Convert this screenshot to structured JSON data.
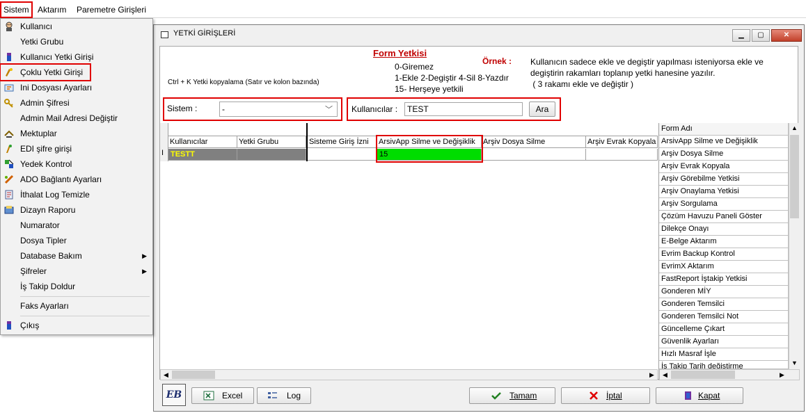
{
  "menubar": {
    "items": [
      {
        "label": "Sistem"
      },
      {
        "label": "Aktarım"
      },
      {
        "label": "Paremetre Girişleri"
      }
    ]
  },
  "dropdown": {
    "items": [
      {
        "label": "Kullanıcı",
        "icon": "user-icon"
      },
      {
        "label": "Yetki Grubu",
        "icon": ""
      },
      {
        "label": "Kullanıcı Yetki Girişi",
        "icon": "user-permission-icon"
      },
      {
        "label": "Çoklu Yetki Girişi",
        "icon": "multi-permission-icon"
      },
      {
        "label": "Ini Dosyası  Ayarları",
        "icon": "ini-settings-icon"
      },
      {
        "label": "Admin Şifresi",
        "icon": "key-icon"
      },
      {
        "label": "Admin Mail Adresi Değiştir",
        "icon": ""
      },
      {
        "label": "Mektuplar",
        "icon": "letter-icon"
      },
      {
        "label": "EDI şifre girişi",
        "icon": "edi-key-icon"
      },
      {
        "label": "Yedek Kontrol",
        "icon": "backup-icon"
      },
      {
        "label": "ADO Bağlantı Ayarları",
        "icon": "connection-icon"
      },
      {
        "label": "İthalat Log Temizle",
        "icon": "log-clean-icon"
      },
      {
        "label": "Dizayn Raporu",
        "icon": "report-icon"
      },
      {
        "label": "Numarator",
        "icon": ""
      },
      {
        "label": "Dosya Tipler",
        "icon": ""
      },
      {
        "label": "Database Bakım",
        "icon": "",
        "submenu": true
      },
      {
        "label": "Şifreler",
        "icon": "",
        "submenu": true
      },
      {
        "label": "İş Takip Doldur",
        "icon": ""
      },
      {
        "label": "Faks Ayarları",
        "icon": ""
      },
      {
        "label": "Çıkış",
        "icon": "exit-icon"
      }
    ]
  },
  "window": {
    "title": "YETKİ GİRİŞLERİ",
    "hint": "Ctrl + K Yetki kopyalama (Satır ve kolon bazında)",
    "form_title": "Form Yetkisi",
    "legend_lines": [
      "0-Giremez",
      "1-Ekle  2-Degiştir  4-Sil  8-Yazdır",
      "15- Herşeye yetkili"
    ],
    "ornek_label": "Örnek :",
    "ornek_text_lines": [
      "Kullanıcın sadece ekle ve degiştir yapılması isteniyorsa  ekle ve",
      "degiştirin rakamları toplanıp yetki hanesine yazılır.",
      " ( 3 rakamı ekle ve değiştir )"
    ],
    "sistem_label": "Sistem :",
    "sistem_value": "-",
    "kullanicilar_label": "Kullanıcılar :",
    "kullanicilar_value": "TEST",
    "ara_label": "Ara"
  },
  "grid": {
    "columns": [
      "Kullanıcılar",
      "Yetki Grubu",
      "Sisteme Giriş İzni",
      "ArsivApp Silme ve Değişiklik",
      "Arşiv Dosya Silme",
      "Arşiv Evrak Kopyala"
    ],
    "row": {
      "user": "TESTT",
      "group": "",
      "login": "",
      "arsivapp": "15",
      "dosya": "",
      "evrak": ""
    },
    "cursor": "I"
  },
  "form_list": {
    "header": "Form Adı",
    "items": [
      "ArsivApp Silme ve Değişiklik",
      "Arşiv Dosya Silme",
      "Arşiv Evrak Kopyala",
      "Arşiv Görebilme Yetkisi",
      "Arşiv Onaylama Yetkisi",
      "Arşiv Sorgulama",
      "Çözüm Havuzu Paneli Göster",
      "Dilekçe Onayı",
      "E-Belge Aktarım",
      "Evrim Backup Kontrol",
      "EvrimX Aktarım",
      "FastReport İştakip Yetkisi",
      "Gonderen MİY",
      "Gonderen Temsilci",
      "Gonderen Temsilci Not",
      "Güncelleme Çıkart",
      "Güvenlik Ayarları",
      "Hızlı Masraf İşle",
      "İş Takip Tarih değiştirme"
    ]
  },
  "buttons": {
    "logo": "EB",
    "excel": "Excel",
    "log": "Log",
    "tamam": "Tamam",
    "iptal": "İptal",
    "kapat": "Kapat"
  },
  "colors": {
    "highlight_red": "#e00000",
    "row_selected": "#808080",
    "row_selected_text": "#ffff00",
    "cell_green": "#00dd00"
  }
}
